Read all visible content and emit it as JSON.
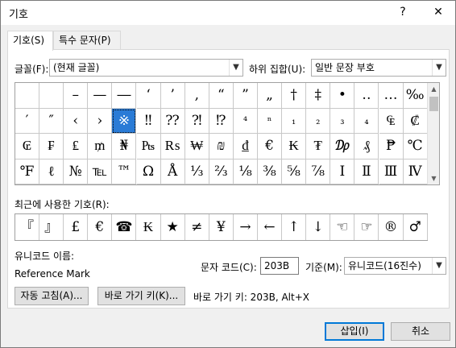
{
  "window": {
    "title": "기호",
    "help_label": "?",
    "close_label": "✕"
  },
  "tabs": [
    {
      "label": "기호(S)",
      "active": true
    },
    {
      "label": "특수 문자(P)",
      "active": false
    }
  ],
  "font": {
    "label": "글꼴(F):",
    "value": "(현재 글꼴)"
  },
  "subset": {
    "label": "하위 집합(U):",
    "value": "일반 문장 부호"
  },
  "symbol_grid": {
    "rows": [
      [
        "",
        "",
        "–",
        "—",
        "―",
        "‘",
        "’",
        "‚",
        "“",
        "”",
        "„",
        "†",
        "‡",
        "•",
        "‥",
        "…",
        "‰"
      ],
      [
        "′",
        "″",
        "‹",
        "›",
        "※",
        "‼",
        "⁇",
        "⁈",
        "⁉",
        "⁴",
        "ⁿ",
        "₁",
        "₂",
        "₃",
        "₄",
        "₠",
        "₡"
      ],
      [
        "₢",
        "₣",
        "₤",
        "₥",
        "₦",
        "₧",
        "₨",
        "₩",
        "₪",
        "₫",
        "€",
        "₭",
        "₮",
        "₯",
        "₰",
        "₱",
        "℃"
      ],
      [
        "℉",
        "ℓ",
        "№",
        "℡",
        "™",
        "Ω",
        "Å",
        "⅓",
        "⅔",
        "⅛",
        "⅜",
        "⅝",
        "⅞",
        "Ⅰ",
        "Ⅱ",
        "Ⅲ",
        "Ⅳ"
      ]
    ],
    "selected": "※"
  },
  "recent": {
    "label": "최근에 사용한 기호(R):",
    "symbols": [
      "『",
      "』",
      "£",
      "€",
      "☎",
      "₭",
      "★",
      "≠",
      "¥",
      "→",
      "←",
      "↑",
      "↓",
      "☜",
      "☞",
      "®",
      "♂"
    ]
  },
  "unicode_name": {
    "label": "유니코드 이름:",
    "value": "Reference Mark"
  },
  "char_code": {
    "label": "문자 코드(C):",
    "value": "203B"
  },
  "from": {
    "label": "기준(M):",
    "value": "유니코드(16진수)"
  },
  "buttons": {
    "autocorrect": "자동 고침(A)...",
    "shortcut_key": "바로 가기 키(K)...",
    "insert": "삽입(I)",
    "cancel": "취소"
  },
  "shortcut_text": "바로 가기 키: 203B, Alt+X"
}
